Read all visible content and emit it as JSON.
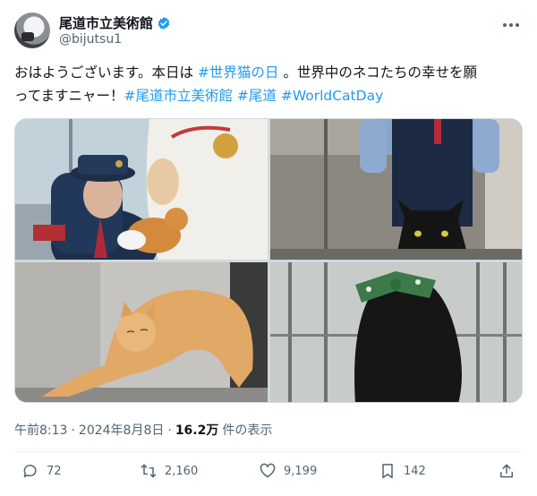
{
  "author": {
    "display_name": "尾道市立美術館",
    "handle": "@bijutsu1"
  },
  "tweet": {
    "line1_prefix": "おはようございます。本日は ",
    "hashtag_catday_jp": "#世界猫の日",
    "line1_suffix": " 。世界中のネコたちの幸せを願",
    "line2_prefix": "ってますニャー！",
    "hashtag_museum": "#尾道市立美術館",
    "hashtag_onomichi": "#尾道",
    "hashtag_worldcatday": "#WorldCatDay"
  },
  "meta": {
    "time": "午前8:13",
    "date": "2024年8月8日",
    "views": "16.2万",
    "views_label": "件の表示"
  },
  "actions": {
    "replies": "72",
    "reposts": "2,160",
    "likes": "9,199",
    "bookmarks": "142"
  },
  "colors": {
    "accent": "#1d9bf0",
    "text": "#0f1419",
    "muted": "#536471"
  },
  "icons": [
    "verified-icon",
    "more-icon",
    "reply-icon",
    "repost-icon",
    "like-icon",
    "bookmark-icon",
    "share-icon"
  ]
}
